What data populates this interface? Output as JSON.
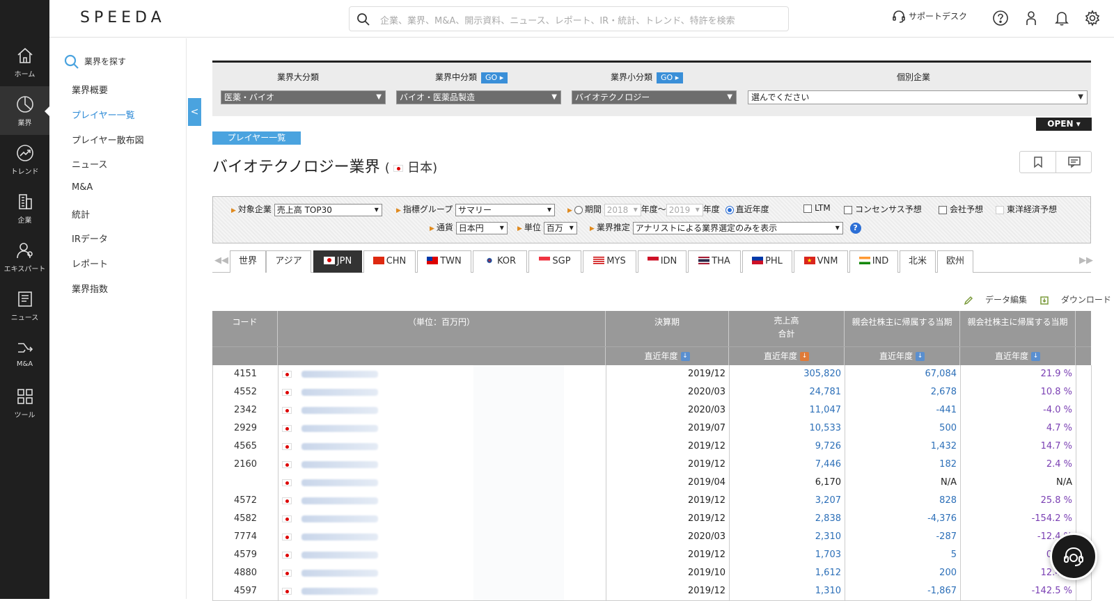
{
  "app": {
    "logo": "SPEEDA"
  },
  "header": {
    "search_placeholder": "企業、業界、M&A、開示資料、ニュース、レポート、IR・統計、トレンド、特許を検索",
    "support_label": "サポートデスク"
  },
  "rail": {
    "items": [
      {
        "label": "ホーム",
        "icon": "home-icon"
      },
      {
        "label": "業界",
        "icon": "pie-chart-icon"
      },
      {
        "label": "トレンド",
        "icon": "trend-icon"
      },
      {
        "label": "企業",
        "icon": "building-icon"
      },
      {
        "label": "エキスパート",
        "icon": "expert-icon"
      },
      {
        "label": "ニュース",
        "icon": "news-icon"
      },
      {
        "label": "M&A",
        "icon": "merger-icon"
      },
      {
        "label": "ツール",
        "icon": "grid-icon"
      }
    ]
  },
  "subnav": {
    "title": "業界を探す",
    "items": [
      "業界概要",
      "プレイヤー一覧",
      "プレイヤー散布図",
      "ニュース",
      "M&A",
      "統計",
      "IRデータ",
      "レポート",
      "業界指数"
    ],
    "collapse_label": "<"
  },
  "filter": {
    "major_label": "業界大分類",
    "mid_label": "業界中分類",
    "minor_label": "業界小分類",
    "company_label": "個別企業",
    "go_label": "GO ▸",
    "major_value": "医薬・バイオ",
    "mid_value": "バイオ・医薬品製造",
    "minor_value": "バイオテクノロジー",
    "company_value": "選んでください",
    "open_label": "OPEN ▾"
  },
  "page": {
    "pill": "プレイヤー一覧",
    "title": "バイオテクノロジー業界",
    "country": "日本"
  },
  "options": {
    "target_label": "対象企業",
    "target_value": "売上高 TOP30",
    "indicator_label": "指標グループ",
    "indicator_value": "サマリー",
    "period_label": "期間",
    "year_from": "2018",
    "year_sep": "年度〜",
    "year_to": "2019",
    "year_suffix": "年度",
    "recent_label": "直近年度",
    "ltm_label": "LTM",
    "consensus_label": "コンセンサス予想",
    "company_forecast_label": "会社予想",
    "toyo_label": "東洋経済予想",
    "currency_label": "通貨",
    "currency_value": "日本円",
    "unit_label": "単位",
    "unit_value": "百万",
    "estimate_label": "業界推定",
    "estimate_value": "アナリストによる業界選定のみを表示",
    "help": "?"
  },
  "tabs": [
    "世界",
    "アジア",
    "JPN",
    "CHN",
    "TWN",
    "KOR",
    "SGP",
    "MYS",
    "IDN",
    "THA",
    "PHL",
    "VNM",
    "IND",
    "北米",
    "欧州"
  ],
  "tools": {
    "edit": "データ編集",
    "download": "ダウンロード"
  },
  "table": {
    "headers": {
      "code": "コード",
      "unit": "（単位：百万円）",
      "period": "決算期",
      "sales": "売上高",
      "sales_sub": "合計",
      "np": "親会社株主に帰属する当期",
      "ratio": "親会社株主に帰属する当期"
    },
    "sub_header": "直近年度",
    "rows": [
      {
        "code": "4151",
        "period": "2019/12",
        "sales": "305,820",
        "np": "67,084",
        "ratio": "21.9 %"
      },
      {
        "code": "4552",
        "period": "2020/03",
        "sales": "24,781",
        "np": "2,678",
        "ratio": "10.8 %"
      },
      {
        "code": "2342",
        "period": "2020/03",
        "sales": "11,047",
        "np": "-441",
        "ratio": "-4.0 %"
      },
      {
        "code": "2929",
        "period": "2019/07",
        "sales": "10,533",
        "np": "500",
        "ratio": "4.7 %"
      },
      {
        "code": "4565",
        "period": "2019/12",
        "sales": "9,726",
        "np": "1,432",
        "ratio": "14.7 %"
      },
      {
        "code": "2160",
        "period": "2019/12",
        "sales": "7,446",
        "np": "182",
        "ratio": "2.4 %"
      },
      {
        "code": "",
        "period": "2019/04",
        "sales": "6,170",
        "np": "N/A",
        "ratio": "N/A"
      },
      {
        "code": "4572",
        "period": "2019/12",
        "sales": "3,207",
        "np": "828",
        "ratio": "25.8 %"
      },
      {
        "code": "4582",
        "period": "2019/12",
        "sales": "2,838",
        "np": "-4,376",
        "ratio": "-154.2 %"
      },
      {
        "code": "7774",
        "period": "2020/03",
        "sales": "2,310",
        "np": "-287",
        "ratio": "-12.4 %"
      },
      {
        "code": "4579",
        "period": "2019/12",
        "sales": "1,703",
        "np": "5",
        "ratio": "0.3 %"
      },
      {
        "code": "4880",
        "period": "2019/10",
        "sales": "1,612",
        "np": "200",
        "ratio": "12.4 %"
      },
      {
        "code": "4597",
        "period": "2019/12",
        "sales": "1,310",
        "np": "-1,867",
        "ratio": "-142.5 %"
      }
    ]
  }
}
